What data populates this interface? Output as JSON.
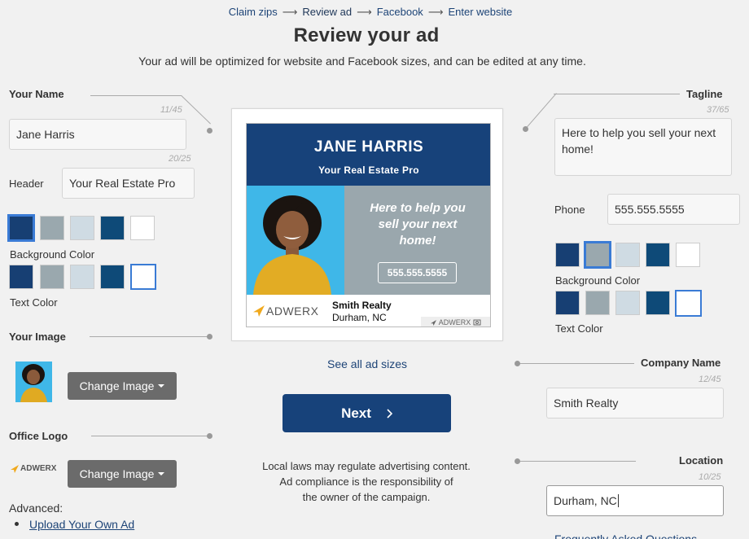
{
  "breadcrumb": [
    "Claim zips",
    "Review ad",
    "Facebook",
    "Enter website"
  ],
  "page": {
    "title": "Review your ad",
    "subtitle": "Your ad will be optimized for website and Facebook sizes, and can be edited at any time."
  },
  "left": {
    "your_name_label": "Your Name",
    "name_counter": "11/45",
    "name_value": "Jane Harris",
    "header_counter": "20/25",
    "header_label": "Header",
    "header_value": "Your Real Estate Pro",
    "bg_color_label": "Background Color",
    "text_color_label": "Text Color",
    "your_image_label": "Your Image",
    "change_image_label": "Change Image",
    "office_logo_label": "Office Logo",
    "change_logo_label": "Change Image",
    "advanced_label": "Advanced:",
    "upload_label": "Upload Your Own Ad"
  },
  "swatch_colors": [
    "#173f73",
    "#9aa8ae",
    "#cfdbe3",
    "#0e4a78",
    "#ffffff"
  ],
  "ad": {
    "name": "JANE HARRIS",
    "header": "Your Real Estate Pro",
    "tagline": "Here to help you sell your next home!",
    "phone": "555.555.5555",
    "company": "Smith Realty",
    "location": "Durham, NC",
    "logo_text": "ADWERX",
    "badge_text": "ADWERX",
    "header_color": "#17427a",
    "panel_color": "#9aa7ad"
  },
  "center": {
    "see_all": "See all ad sizes",
    "next_label": "Next",
    "legal": [
      "Local laws may regulate advertising content.",
      "Ad compliance is the responsibility of",
      "the owner of the campaign."
    ]
  },
  "right": {
    "tagline_label": "Tagline",
    "tagline_counter": "37/65",
    "tagline_value": "Here to help you sell your next home!",
    "phone_label": "Phone",
    "phone_value": "555.555.5555",
    "bg_color_label": "Background Color",
    "text_color_label": "Text Color",
    "company_label": "Company Name",
    "company_counter": "12/45",
    "company_value": "Smith Realty",
    "location_label": "Location",
    "location_counter": "10/25",
    "location_value": "Durham, NC",
    "faq_label": "Frequently Asked Questions"
  }
}
